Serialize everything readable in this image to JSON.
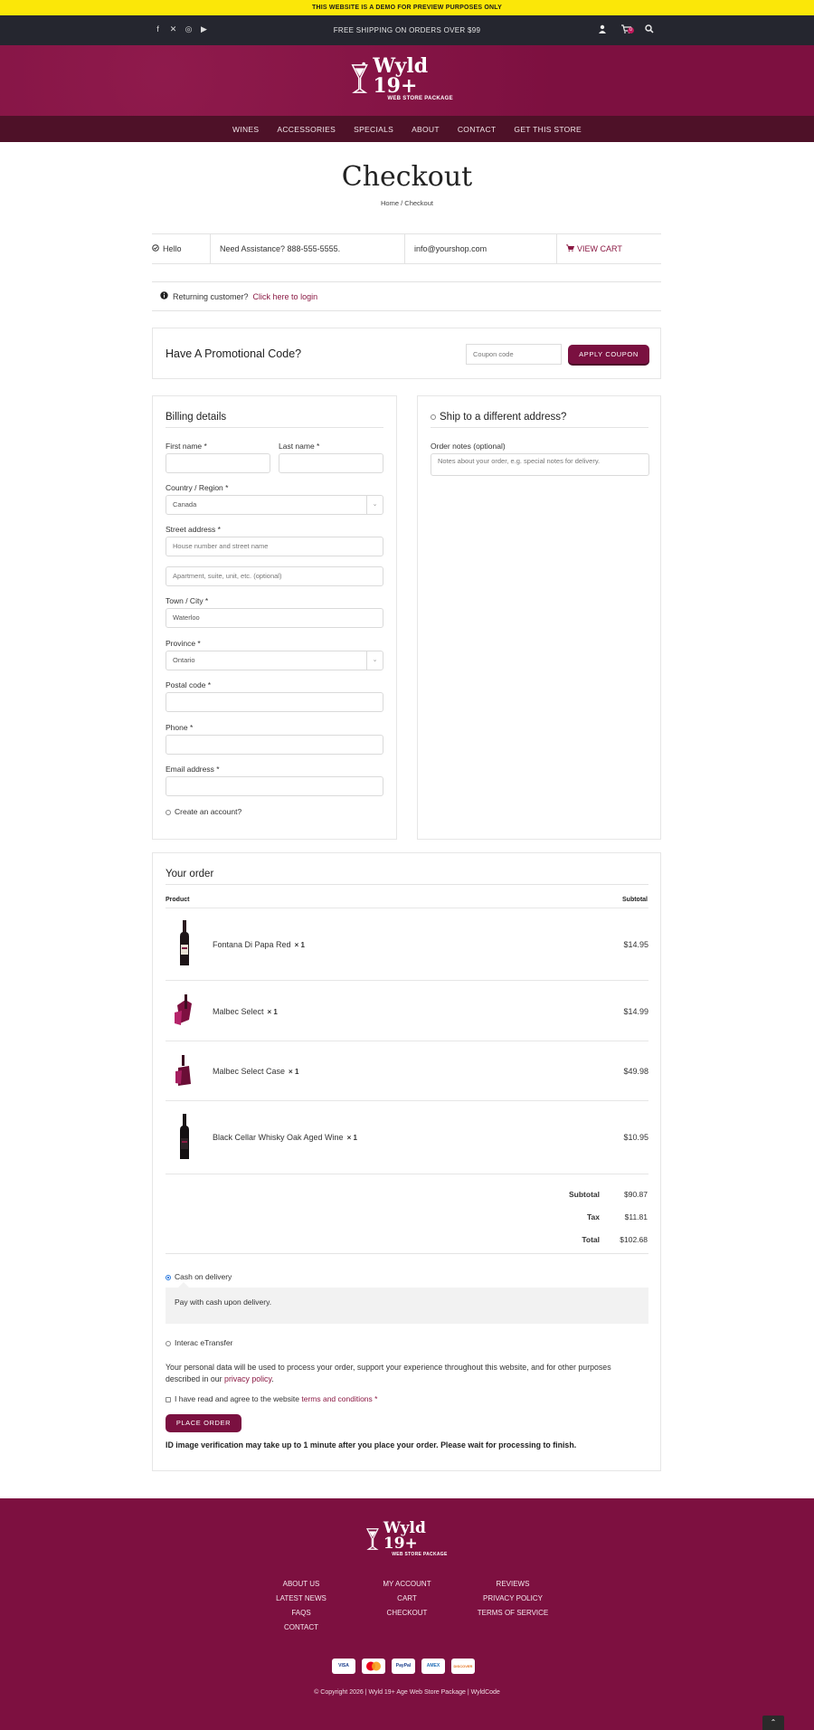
{
  "demo_banner": "THIS WEBSITE IS A DEMO FOR PREVIEW PURPOSES ONLY",
  "infobar": {
    "shipping_note": "FREE SHIPPING ON ORDERS OVER $99",
    "social_icons": [
      "facebook-icon",
      "x-icon",
      "instagram-icon",
      "youtube-icon"
    ],
    "cart_count": "0"
  },
  "logo": {
    "brand": "Wyld 19+",
    "sub": "WEB STORE PACKAGE"
  },
  "nav": [
    "WINES",
    "ACCESSORIES",
    "SPECIALS",
    "ABOUT",
    "CONTACT",
    "GET THIS STORE"
  ],
  "page": {
    "title": "Checkout",
    "breadcrumb": "Home / Checkout"
  },
  "infostrip": {
    "hello": "Hello",
    "assistance": "Need Assistance? 888-555-5555.",
    "email": "info@yourshop.com",
    "view_cart": "VIEW CART"
  },
  "returning": {
    "text": "Returning customer?",
    "link": "Click here to login"
  },
  "promo": {
    "title": "Have A Promotional Code?",
    "placeholder": "Coupon code",
    "button": "APPLY COUPON"
  },
  "billing": {
    "title": "Billing details",
    "first_name": "First name *",
    "last_name": "Last name *",
    "country_label": "Country / Region *",
    "country_value": "Canada",
    "street_label": "Street address *",
    "street_placeholder": "House number and street name",
    "apt_placeholder": "Apartment, suite, unit, etc. (optional)",
    "city_label": "Town / City *",
    "city_value": "Waterloo",
    "province_label": "Province *",
    "province_value": "Ontario",
    "postal_label": "Postal code *",
    "phone_label": "Phone *",
    "email_label": "Email address *",
    "create_account": "Create an account?"
  },
  "shipping": {
    "title": "Ship to a different address?",
    "notes_label": "Order notes (optional)",
    "notes_placeholder": "Notes about your order, e.g. special notes for delivery."
  },
  "order": {
    "title": "Your order",
    "col_product": "Product",
    "col_subtotal": "Subtotal",
    "items": [
      {
        "name": "Fontana Di Papa Red",
        "qty": "× 1",
        "price": "$14.95"
      },
      {
        "name": "Malbec Select",
        "qty": "× 1",
        "price": "$14.99"
      },
      {
        "name": "Malbec Select Case",
        "qty": "× 1",
        "price": "$49.98"
      },
      {
        "name": "Black Cellar Whisky Oak Aged Wine",
        "qty": "× 1",
        "price": "$10.95"
      }
    ],
    "subtotal_label": "Subtotal",
    "subtotal": "$90.87",
    "tax_label": "Tax",
    "tax": "$11.81",
    "total_label": "Total",
    "total": "$102.68"
  },
  "payment": {
    "cod": "Cash on delivery",
    "cod_desc": "Pay with cash upon delivery.",
    "interac": "Interac eTransfer",
    "privacy_text": "Your personal data will be used to process your order, support your experience throughout this website, and for other purposes described in our",
    "privacy_link": "privacy policy",
    "terms_text": "I have read and agree to the website",
    "terms_link": "terms and conditions",
    "terms_req": "*",
    "place_order": "PLACE ORDER",
    "verification": "ID image verification may take up to 1 minute after you place your order. Please wait for processing to finish."
  },
  "footer": {
    "col1": [
      "ABOUT US",
      "LATEST NEWS",
      "FAQS",
      "CONTACT"
    ],
    "col2": [
      "MY ACCOUNT",
      "CART",
      "CHECKOUT"
    ],
    "col3": [
      "REVIEWS",
      "PRIVACY POLICY",
      "TERMS OF SERVICE"
    ],
    "cards": [
      "VISA",
      "MC",
      "PayPal",
      "AMEX",
      "DISCOVER"
    ],
    "copyright": "© Copyright 2026 | Wyld 19+ Age Web Store Package | WyldCode"
  },
  "colors": {
    "accent": "#7d1040",
    "banner": "#fbe708",
    "dark": "#25262f"
  }
}
